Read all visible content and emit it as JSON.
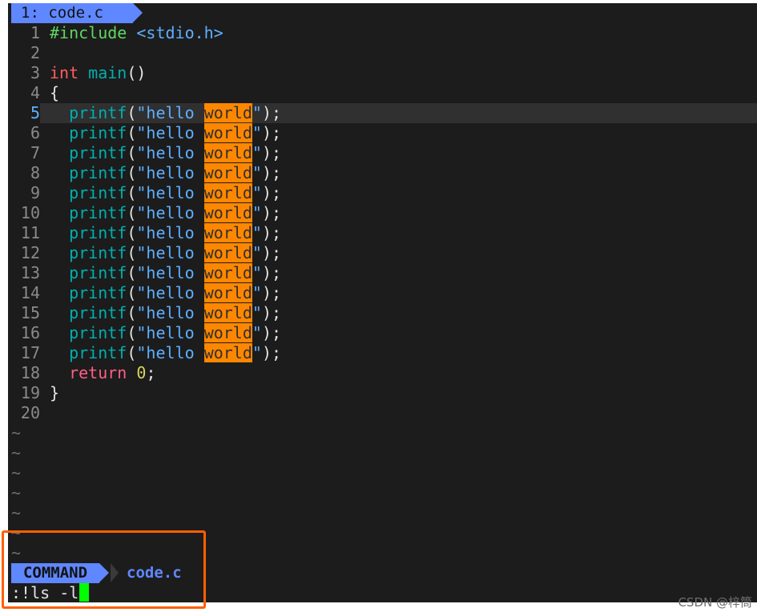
{
  "tab": {
    "label": "1: code.c"
  },
  "buffer": {
    "lines": [
      {
        "n": "1",
        "parts": [
          {
            "t": "#include ",
            "c": "kw-inc"
          },
          {
            "t": "<stdio.h>",
            "c": "s-str"
          }
        ]
      },
      {
        "n": "2",
        "parts": []
      },
      {
        "n": "3",
        "parts": [
          {
            "t": "int",
            "c": "s-type"
          },
          {
            "t": " ",
            "c": ""
          },
          {
            "t": "main",
            "c": "s-func"
          },
          {
            "t": "()",
            "c": ""
          }
        ]
      },
      {
        "n": "4",
        "parts": [
          {
            "t": "{",
            "c": ""
          }
        ]
      },
      {
        "n": "5",
        "current": true,
        "parts": [
          {
            "t": "  ",
            "c": ""
          },
          {
            "t": "printf",
            "c": "s-func"
          },
          {
            "t": "(",
            "c": ""
          },
          {
            "t": "\"hello ",
            "c": "s-str"
          },
          {
            "t": "world",
            "c": "hl"
          },
          {
            "t": "\"",
            "c": "s-str"
          },
          {
            "t": ");",
            "c": ""
          }
        ]
      },
      {
        "n": "6",
        "parts": [
          {
            "t": "  ",
            "c": ""
          },
          {
            "t": "printf",
            "c": "s-func"
          },
          {
            "t": "(",
            "c": ""
          },
          {
            "t": "\"hello ",
            "c": "s-str"
          },
          {
            "t": "world",
            "c": "hl"
          },
          {
            "t": "\"",
            "c": "s-str"
          },
          {
            "t": ");",
            "c": ""
          }
        ]
      },
      {
        "n": "7",
        "parts": [
          {
            "t": "  ",
            "c": ""
          },
          {
            "t": "printf",
            "c": "s-func"
          },
          {
            "t": "(",
            "c": ""
          },
          {
            "t": "\"hello ",
            "c": "s-str"
          },
          {
            "t": "world",
            "c": "hl"
          },
          {
            "t": "\"",
            "c": "s-str"
          },
          {
            "t": ");",
            "c": ""
          }
        ]
      },
      {
        "n": "8",
        "parts": [
          {
            "t": "  ",
            "c": ""
          },
          {
            "t": "printf",
            "c": "s-func"
          },
          {
            "t": "(",
            "c": ""
          },
          {
            "t": "\"hello ",
            "c": "s-str"
          },
          {
            "t": "world",
            "c": "hl"
          },
          {
            "t": "\"",
            "c": "s-str"
          },
          {
            "t": ");",
            "c": ""
          }
        ]
      },
      {
        "n": "9",
        "parts": [
          {
            "t": "  ",
            "c": ""
          },
          {
            "t": "printf",
            "c": "s-func"
          },
          {
            "t": "(",
            "c": ""
          },
          {
            "t": "\"hello ",
            "c": "s-str"
          },
          {
            "t": "world",
            "c": "hl"
          },
          {
            "t": "\"",
            "c": "s-str"
          },
          {
            "t": ");",
            "c": ""
          }
        ]
      },
      {
        "n": "10",
        "parts": [
          {
            "t": "  ",
            "c": ""
          },
          {
            "t": "printf",
            "c": "s-func"
          },
          {
            "t": "(",
            "c": ""
          },
          {
            "t": "\"hello ",
            "c": "s-str"
          },
          {
            "t": "world",
            "c": "hl"
          },
          {
            "t": "\"",
            "c": "s-str"
          },
          {
            "t": ");",
            "c": ""
          }
        ]
      },
      {
        "n": "11",
        "parts": [
          {
            "t": "  ",
            "c": ""
          },
          {
            "t": "printf",
            "c": "s-func"
          },
          {
            "t": "(",
            "c": ""
          },
          {
            "t": "\"hello ",
            "c": "s-str"
          },
          {
            "t": "world",
            "c": "hl"
          },
          {
            "t": "\"",
            "c": "s-str"
          },
          {
            "t": ");",
            "c": ""
          }
        ]
      },
      {
        "n": "12",
        "parts": [
          {
            "t": "  ",
            "c": ""
          },
          {
            "t": "printf",
            "c": "s-func"
          },
          {
            "t": "(",
            "c": ""
          },
          {
            "t": "\"hello ",
            "c": "s-str"
          },
          {
            "t": "world",
            "c": "hl"
          },
          {
            "t": "\"",
            "c": "s-str"
          },
          {
            "t": ");",
            "c": ""
          }
        ]
      },
      {
        "n": "13",
        "parts": [
          {
            "t": "  ",
            "c": ""
          },
          {
            "t": "printf",
            "c": "s-func"
          },
          {
            "t": "(",
            "c": ""
          },
          {
            "t": "\"hello ",
            "c": "s-str"
          },
          {
            "t": "world",
            "c": "hl"
          },
          {
            "t": "\"",
            "c": "s-str"
          },
          {
            "t": ");",
            "c": ""
          }
        ]
      },
      {
        "n": "14",
        "parts": [
          {
            "t": "  ",
            "c": ""
          },
          {
            "t": "printf",
            "c": "s-func"
          },
          {
            "t": "(",
            "c": ""
          },
          {
            "t": "\"hello ",
            "c": "s-str"
          },
          {
            "t": "world",
            "c": "hl"
          },
          {
            "t": "\"",
            "c": "s-str"
          },
          {
            "t": ");",
            "c": ""
          }
        ]
      },
      {
        "n": "15",
        "parts": [
          {
            "t": "  ",
            "c": ""
          },
          {
            "t": "printf",
            "c": "s-func"
          },
          {
            "t": "(",
            "c": ""
          },
          {
            "t": "\"hello ",
            "c": "s-str"
          },
          {
            "t": "world",
            "c": "hl"
          },
          {
            "t": "\"",
            "c": "s-str"
          },
          {
            "t": ");",
            "c": ""
          }
        ]
      },
      {
        "n": "16",
        "parts": [
          {
            "t": "  ",
            "c": ""
          },
          {
            "t": "printf",
            "c": "s-func"
          },
          {
            "t": "(",
            "c": ""
          },
          {
            "t": "\"hello ",
            "c": "s-str"
          },
          {
            "t": "world",
            "c": "hl"
          },
          {
            "t": "\"",
            "c": "s-str"
          },
          {
            "t": ");",
            "c": ""
          }
        ]
      },
      {
        "n": "17",
        "parts": [
          {
            "t": "  ",
            "c": ""
          },
          {
            "t": "printf",
            "c": "s-func"
          },
          {
            "t": "(",
            "c": ""
          },
          {
            "t": "\"hello ",
            "c": "s-str"
          },
          {
            "t": "world",
            "c": "hl"
          },
          {
            "t": "\"",
            "c": "s-str"
          },
          {
            "t": ");",
            "c": ""
          }
        ]
      },
      {
        "n": "18",
        "parts": [
          {
            "t": "  ",
            "c": ""
          },
          {
            "t": "return",
            "c": "s-ret"
          },
          {
            "t": " ",
            "c": ""
          },
          {
            "t": "0",
            "c": "s-num"
          },
          {
            "t": ";",
            "c": ""
          }
        ]
      },
      {
        "n": "19",
        "parts": [
          {
            "t": "}",
            "c": ""
          }
        ]
      },
      {
        "n": "20",
        "parts": []
      }
    ],
    "tildes": [
      "~",
      "~",
      "~",
      "~",
      "~",
      "~",
      "~"
    ]
  },
  "statusline": {
    "mode": "COMMAND",
    "file": "code.c"
  },
  "cmdline": {
    "text": ":!ls -l"
  },
  "watermark": "CSDN @梓筒",
  "colors": {
    "accent": "#5f87ff",
    "search_highlight": "#ff8700",
    "cursor": "#00ff00",
    "annotation_box": "#ff5f00",
    "background": "#1c1c1c"
  }
}
